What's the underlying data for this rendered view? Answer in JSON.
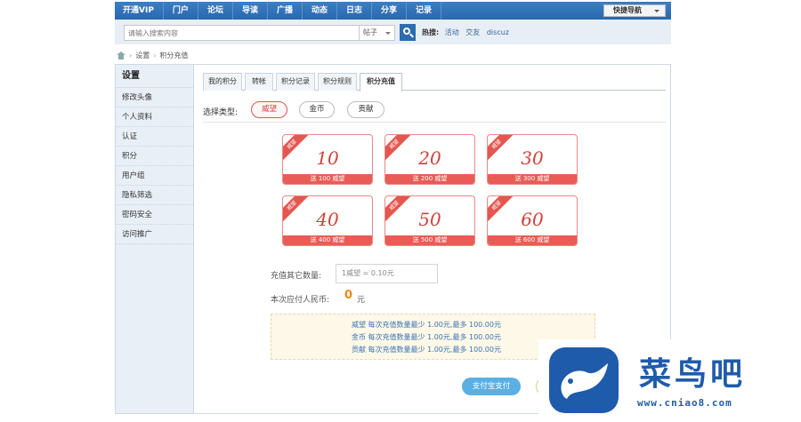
{
  "topnav": {
    "items": [
      "开通VIP",
      "门户",
      "论坛",
      "导读",
      "广播",
      "动态",
      "日志",
      "分享",
      "记录"
    ],
    "quick_nav": "快捷导航"
  },
  "search": {
    "placeholder": "请输入搜索内容",
    "type": "帖子",
    "hot_label": "热搜:",
    "hot_items": [
      "活动",
      "交友",
      "discuz"
    ]
  },
  "breadcrumb": [
    "设置",
    "积分充值"
  ],
  "sidebar": {
    "title": "设置",
    "items": [
      "修改头像",
      "个人资料",
      "认证",
      "积分",
      "用户组",
      "隐私筛选",
      "密码安全",
      "访问推广"
    ]
  },
  "tabs": [
    "我的积分",
    "转帐",
    "积分记录",
    "积分规则",
    "积分充值"
  ],
  "type_select": {
    "label": "选择类型:",
    "options": [
      "威望",
      "金币",
      "贡献"
    ],
    "selected": "威望"
  },
  "cards": [
    {
      "ribbon": "威望",
      "amount": "10",
      "bonus": "送 100 威望"
    },
    {
      "ribbon": "威望",
      "amount": "20",
      "bonus": "送 200 威望"
    },
    {
      "ribbon": "威望",
      "amount": "30",
      "bonus": "送 300 威望"
    },
    {
      "ribbon": "威望",
      "amount": "40",
      "bonus": "送 400 威望"
    },
    {
      "ribbon": "威望",
      "amount": "50",
      "bonus": "送 500 威望"
    },
    {
      "ribbon": "威望",
      "amount": "60",
      "bonus": "送 600 威望"
    }
  ],
  "form": {
    "other_label": "充值其它数量:",
    "other_value": "1威望 = 0.10元",
    "pay_label": "本次应付人民币:",
    "pay_amount": "0",
    "pay_unit": "元"
  },
  "notice": [
    "威望 每次充值数量最少 1.00元,最多 100.00元",
    "金币 每次充值数量最少 1.00元,最多 100.00元",
    "贡献 每次充值数量最少 1.00元,最多 100.00元"
  ],
  "buttons": {
    "alipay": "支付宝支付"
  },
  "watermark": {
    "brand": "菜鸟吧",
    "url": "www.cniao8.com"
  },
  "colors": {
    "nav_blue": "#2b6cb0",
    "accent_red": "#e4564f",
    "pay_orange": "#f0891f",
    "link_blue": "#3a73b4"
  }
}
